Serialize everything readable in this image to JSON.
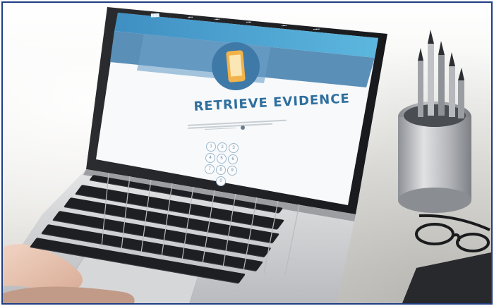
{
  "screen": {
    "title": "RETRIEVE EVIDENCE"
  },
  "keypad": {
    "keys": [
      "1",
      "2",
      "3",
      "4",
      "5",
      "6",
      "7",
      "8",
      "9",
      "0"
    ]
  },
  "colors": {
    "frame_border": "#1f3f84",
    "screen_header_blue": "#4fb3dd",
    "title_blue": "#2f6f9e",
    "laptop_silver": "#c9cacc",
    "keyboard_black": "#1d1f22"
  }
}
